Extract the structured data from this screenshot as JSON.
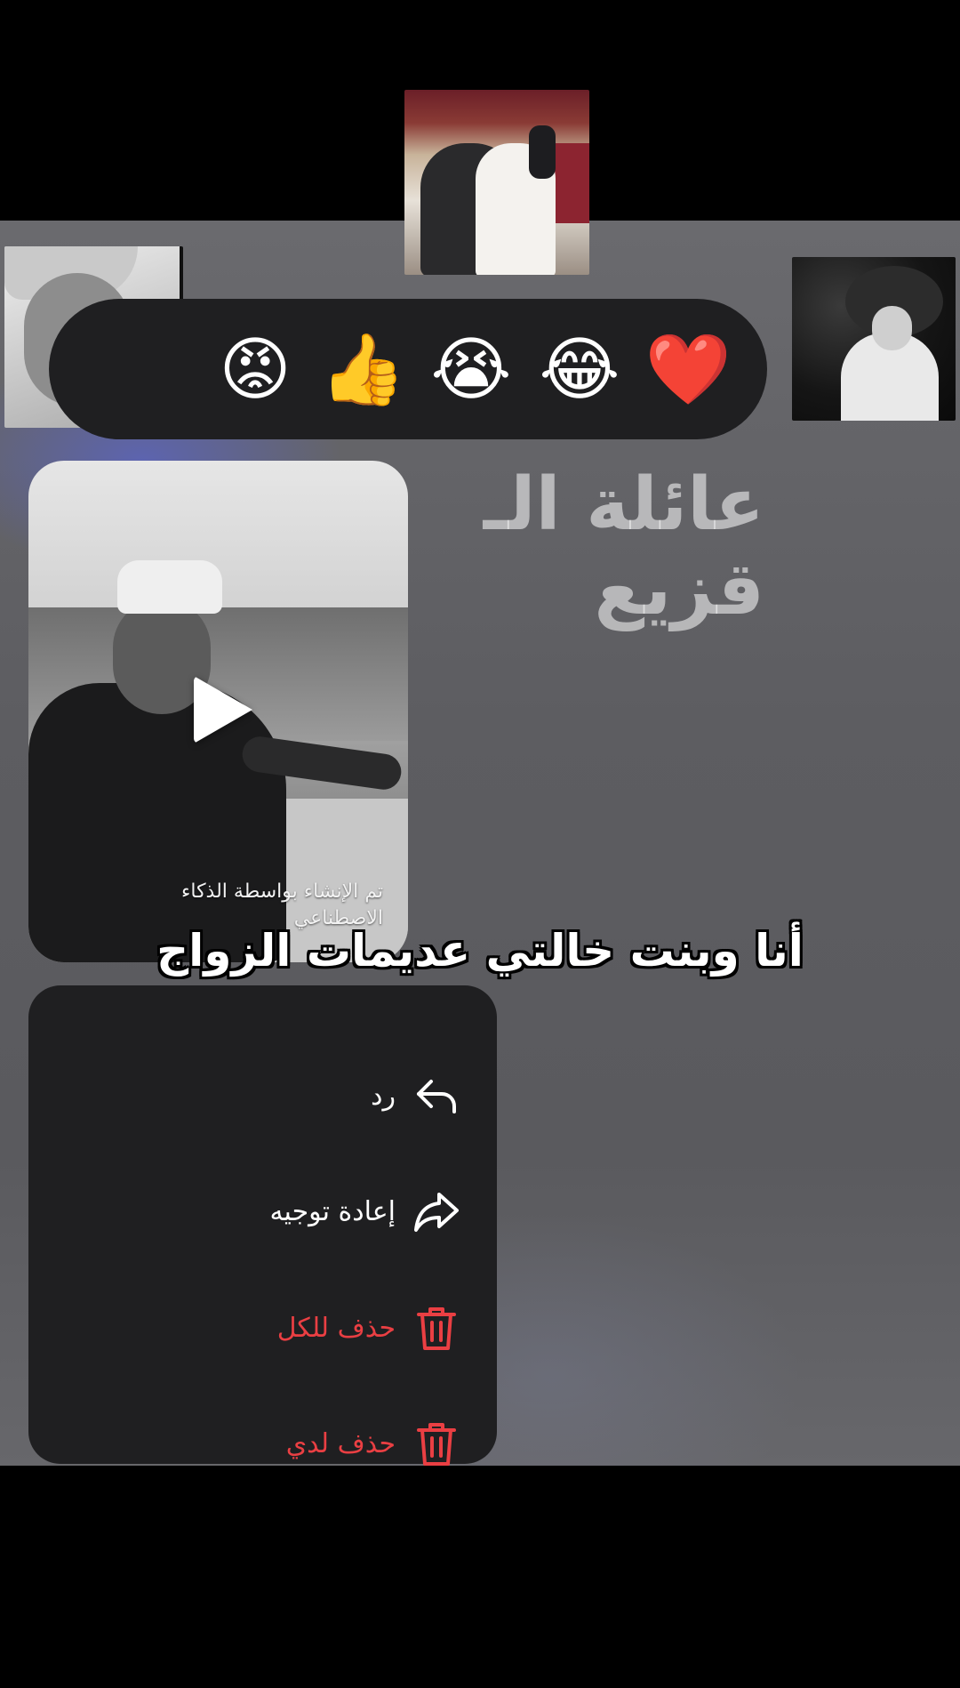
{
  "colors": {
    "danger": "#ea3f43",
    "menu_bg": "#1f1f21",
    "backdrop": "#5d5d61"
  },
  "header_photos": [
    {
      "name": "group-photo-top",
      "description": ""
    },
    {
      "name": "profile-photo-left",
      "description": ""
    },
    {
      "name": "profile-photo-right",
      "description": ""
    }
  ],
  "reactions": [
    {
      "emoji": "😡",
      "icon": "angry-face-icon"
    },
    {
      "emoji": "👍",
      "icon": "thumbs-up-icon"
    },
    {
      "emoji": "😭",
      "icon": "crying-face-icon"
    },
    {
      "emoji": "😂",
      "icon": "laughing-face-icon"
    },
    {
      "emoji": "❤️",
      "icon": "heart-icon"
    }
  ],
  "group_name": "عائلة الـ قزيع",
  "video": {
    "ai_label": "تم الإنشاء بواسطة الذكاء الاصطناعي",
    "play_icon": "play-icon"
  },
  "caption": "أنا وبنت خالتي عديمات الزواج",
  "menu": {
    "reply": {
      "label": "رد",
      "icon": "reply-arrow-icon"
    },
    "forward": {
      "label": "إعادة توجيه",
      "icon": "forward-arrow-icon"
    },
    "delete_all": {
      "label": "حذف للكل",
      "icon": "trash-icon"
    },
    "delete_me": {
      "label": "حذف لدي",
      "icon": "trash-icon"
    }
  }
}
